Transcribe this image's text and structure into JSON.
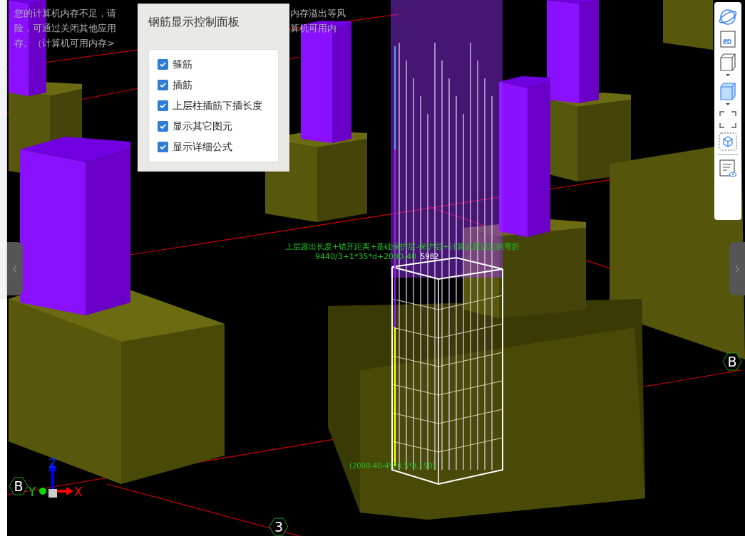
{
  "warning": {
    "left_lines": [
      "您的计算机内存不足，请",
      "险，可通过关闭其他应用",
      "存。（计算机可用内存>"
    ],
    "right_lines": [
      "内存溢出等风",
      "算机可用内"
    ]
  },
  "panel": {
    "title": "钢筋显示控制面板",
    "options": [
      {
        "label": "箍筋",
        "checked": true
      },
      {
        "label": "插筋",
        "checked": true
      },
      {
        "label": "上层柱插筋下插长度",
        "checked": true
      },
      {
        "label": "显示其它图元",
        "checked": true
      },
      {
        "label": "显示详细公式",
        "checked": true
      }
    ]
  },
  "scene": {
    "formula_label": "上层露出长度+错开距离+基础保护层-保护层+计算设置设定的弯折",
    "formula_value": "9440/3+1*35*d+2000-40",
    "length_label": "5982",
    "bottom_label": "(2000-40-4*20.5*d,150)",
    "grid_labels": [
      "B",
      "3",
      "B"
    ],
    "axes": {
      "x": "X",
      "y": "Y",
      "z": "Z"
    }
  }
}
